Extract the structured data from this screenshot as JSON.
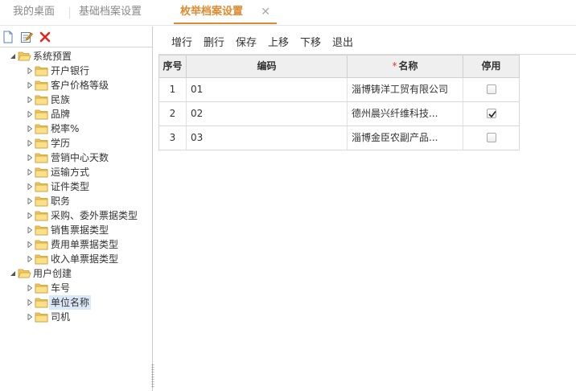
{
  "tabs": [
    {
      "label": "我的桌面"
    },
    {
      "label": "基础档案设置"
    },
    {
      "label": "枚举档案设置",
      "close": "✕"
    }
  ],
  "colors": {
    "accent": "#e08a2f",
    "required": "#ee3333",
    "selected_node": "#dbe8fa"
  },
  "left_toolbar": {
    "icons": [
      "new-document-icon",
      "edit-icon",
      "delete-icon"
    ]
  },
  "tree": {
    "groups": [
      {
        "label": "系统预置",
        "expanded": true,
        "children": [
          "开户银行",
          "客户价格等级",
          "民族",
          "品牌",
          "税率%",
          "学历",
          "营销中心天数",
          "运输方式",
          "证件类型",
          "职务",
          "采购、委外票据类型",
          "销售票据类型",
          "费用单票据类型",
          "收入单票据类型"
        ]
      },
      {
        "label": "用户创建",
        "expanded": true,
        "children": [
          "车号",
          "单位名称",
          "司机"
        ],
        "selected": "单位名称"
      }
    ]
  },
  "toolbar": {
    "add_row": "增行",
    "delete_row": "删行",
    "save": "保存",
    "move_up": "上移",
    "move_down": "下移",
    "exit": "退出"
  },
  "grid": {
    "headers": {
      "index": "序号",
      "code": "编码",
      "required_mark": "*",
      "name": "名称",
      "disabled": "停用"
    },
    "rows": [
      {
        "index": "1",
        "code": "01",
        "name": "淄博铸洋工贸有限公司",
        "disabled": false
      },
      {
        "index": "2",
        "code": "02",
        "name": "德州晨兴纤维科技...",
        "disabled": true
      },
      {
        "index": "3",
        "code": "03",
        "name": "淄博金臣农副产品...",
        "disabled": false
      }
    ]
  }
}
